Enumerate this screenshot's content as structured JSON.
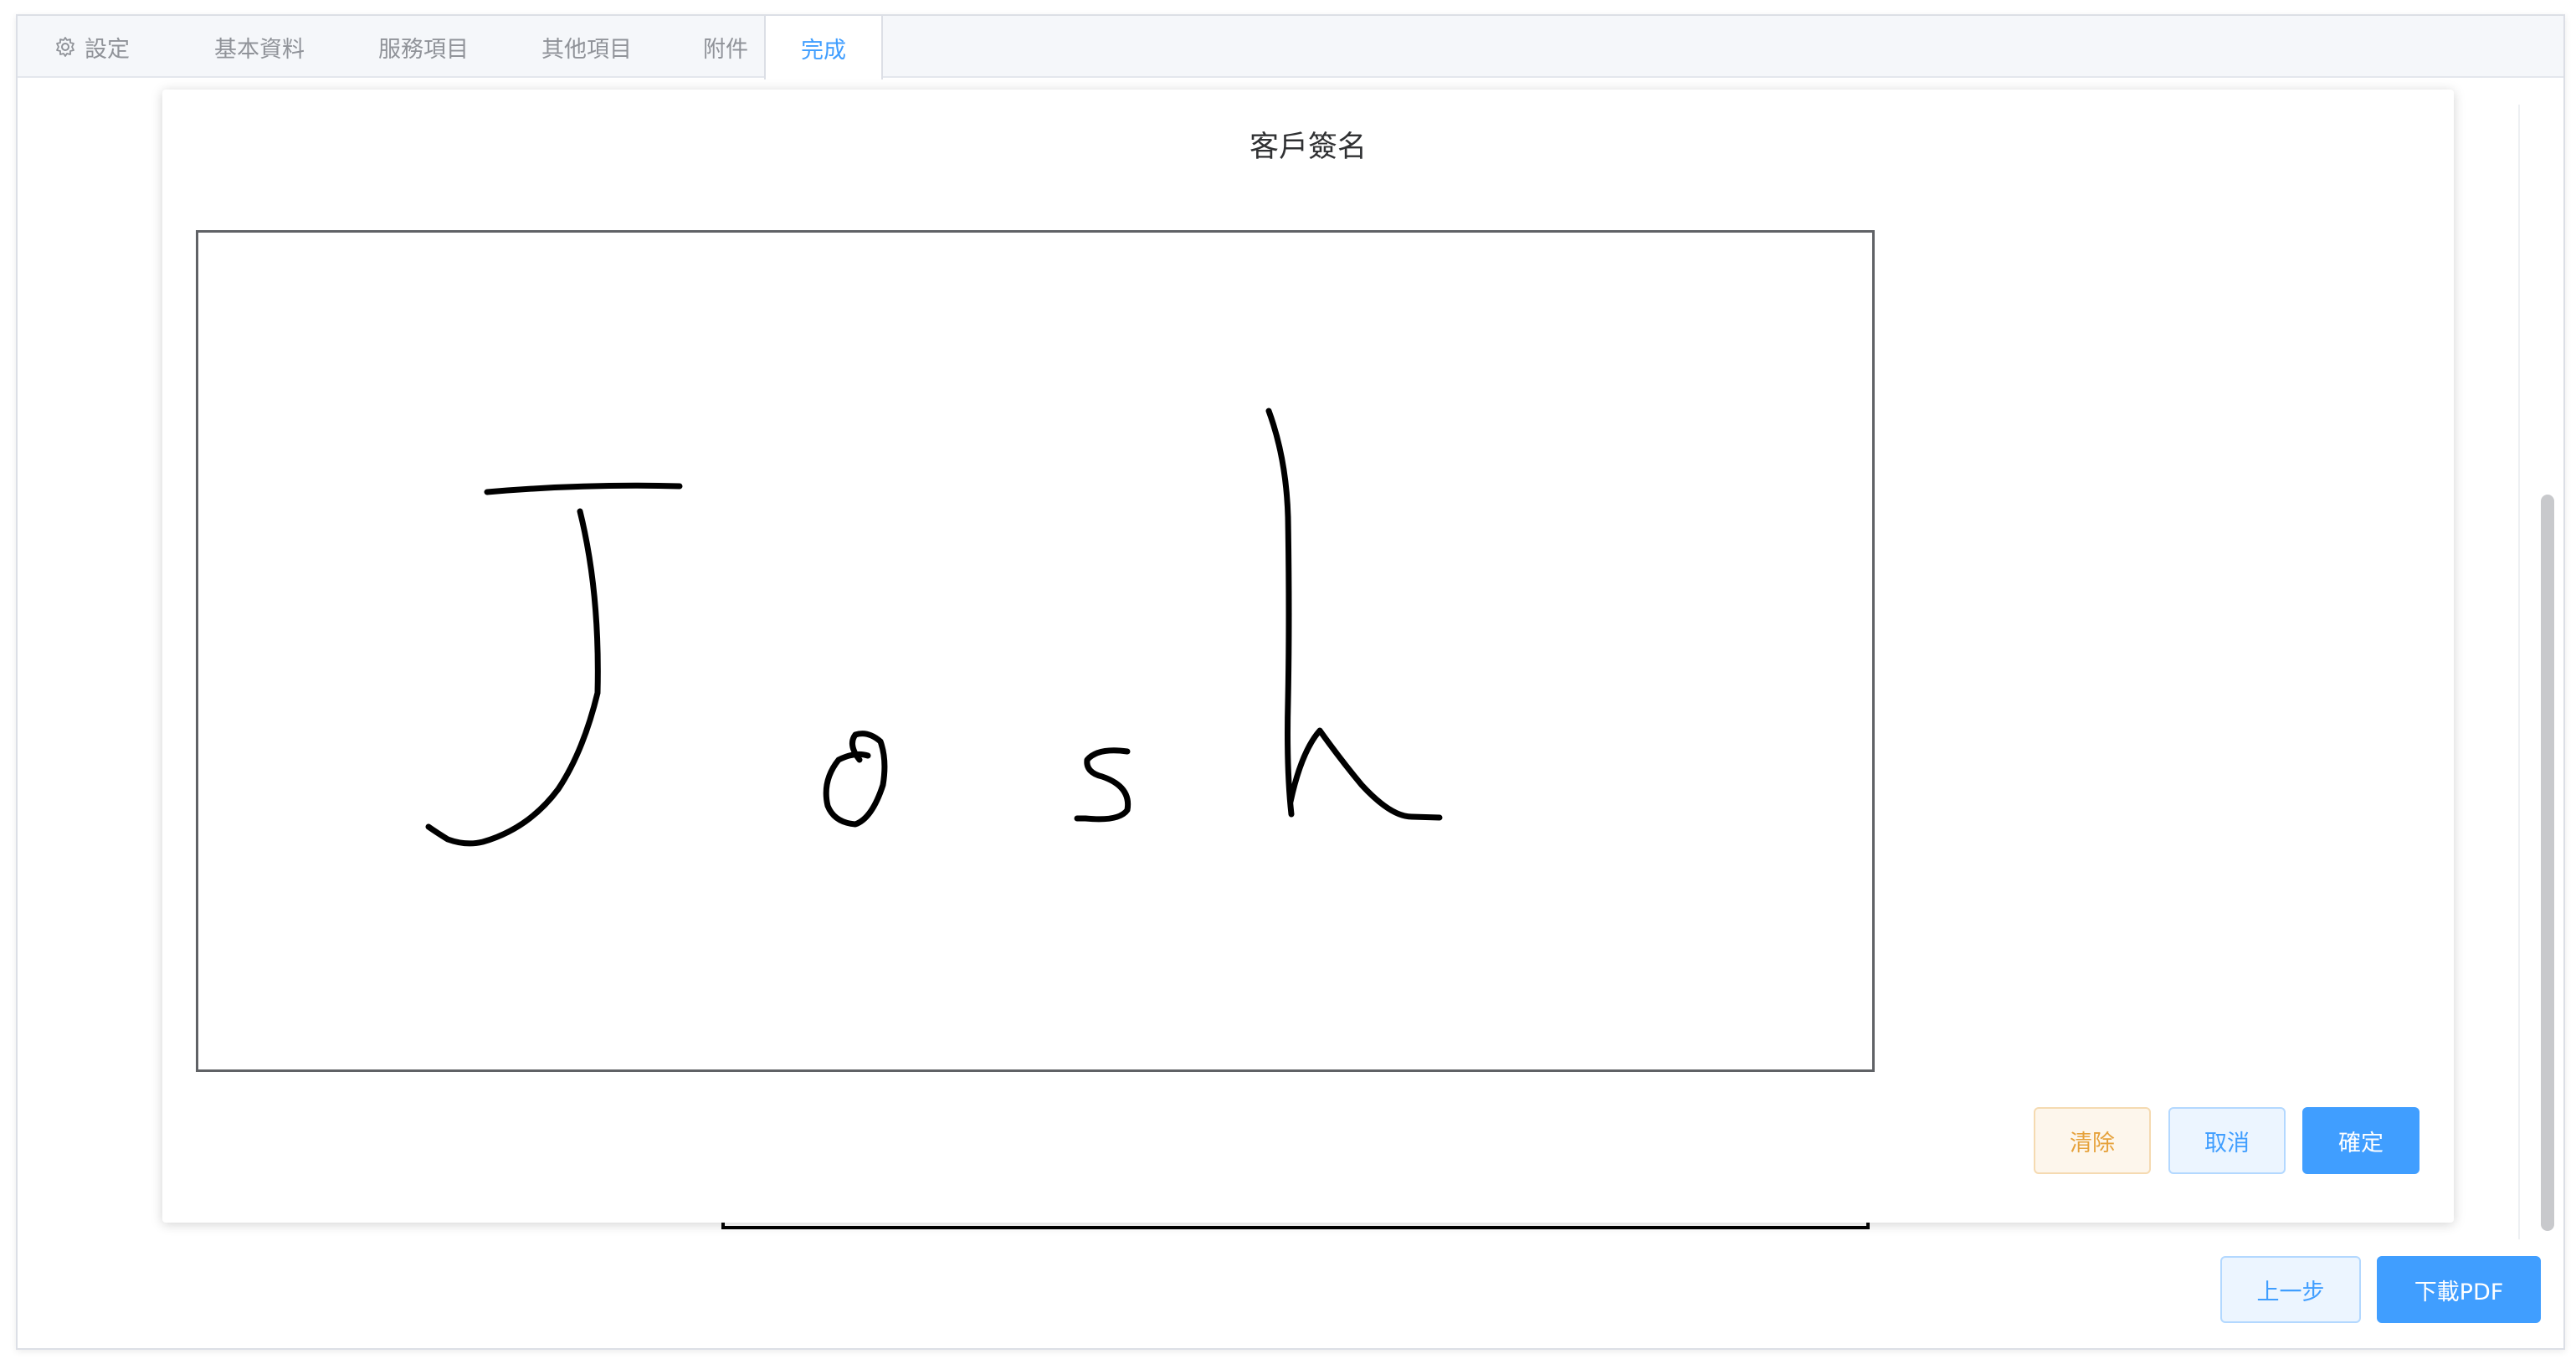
{
  "tabs": [
    {
      "label": "設定",
      "icon": "gear-icon",
      "active": false
    },
    {
      "label": "基本資料",
      "active": false
    },
    {
      "label": "服務項目",
      "active": false
    },
    {
      "label": "其他項目",
      "active": false
    },
    {
      "label": "附件",
      "active": false
    },
    {
      "label": "完成",
      "active": true
    }
  ],
  "dialog": {
    "title": "客戶簽名",
    "buttons": {
      "clear": "清除",
      "cancel": "取消",
      "confirm": "確定"
    }
  },
  "footer": {
    "prev_label": "上一步",
    "download_label": "下載PDF"
  },
  "colors": {
    "primary": "#409eff",
    "warning": "#e6a23c",
    "tab_text": "#909399"
  }
}
